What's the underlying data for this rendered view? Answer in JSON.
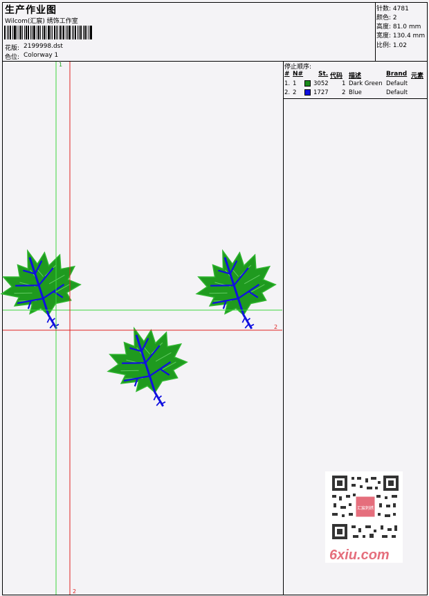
{
  "header": {
    "title": "生产作业图",
    "company": "Wilcom(汇宸) 绣饰工作室",
    "design_label": "花版:",
    "design_value": "2199998.dst",
    "colorway_label": "色位:",
    "colorway_value": "Colorway 1"
  },
  "stats": [
    {
      "label": "针数:",
      "value": "4781"
    },
    {
      "label": "颜色:",
      "value": "2"
    },
    {
      "label": "高度:",
      "value": "81.0 mm"
    },
    {
      "label": "宽度:",
      "value": "130.4 mm"
    },
    {
      "label": "比例:",
      "value": "1.02"
    }
  ],
  "stop_sequence": {
    "title": "停止顺序:",
    "headers": [
      "#",
      "N#",
      "St.",
      "代码",
      "描述",
      "Brand",
      "元素"
    ],
    "rows": [
      {
        "index": "1.",
        "n": "1",
        "stitches": "3052",
        "code": "1",
        "description": "Dark Green",
        "brand": "Default",
        "color": "#1a8a1a"
      },
      {
        "index": "2.",
        "n": "2",
        "stitches": "1727",
        "code": "2",
        "description": "Blue",
        "brand": "Default",
        "color": "#1010e0"
      }
    ]
  },
  "guides": {
    "green_label_top": "1",
    "red_label_right": "2",
    "red_label_bottom": "2"
  },
  "watermark": {
    "brand": "6xiu.com",
    "seal": "汇宸刺绣"
  },
  "colors": {
    "leaf_green": "#1f9a1f",
    "vein_blue": "#1010e0",
    "guide_green": "#3cd63c",
    "guide_red": "#e02020"
  }
}
